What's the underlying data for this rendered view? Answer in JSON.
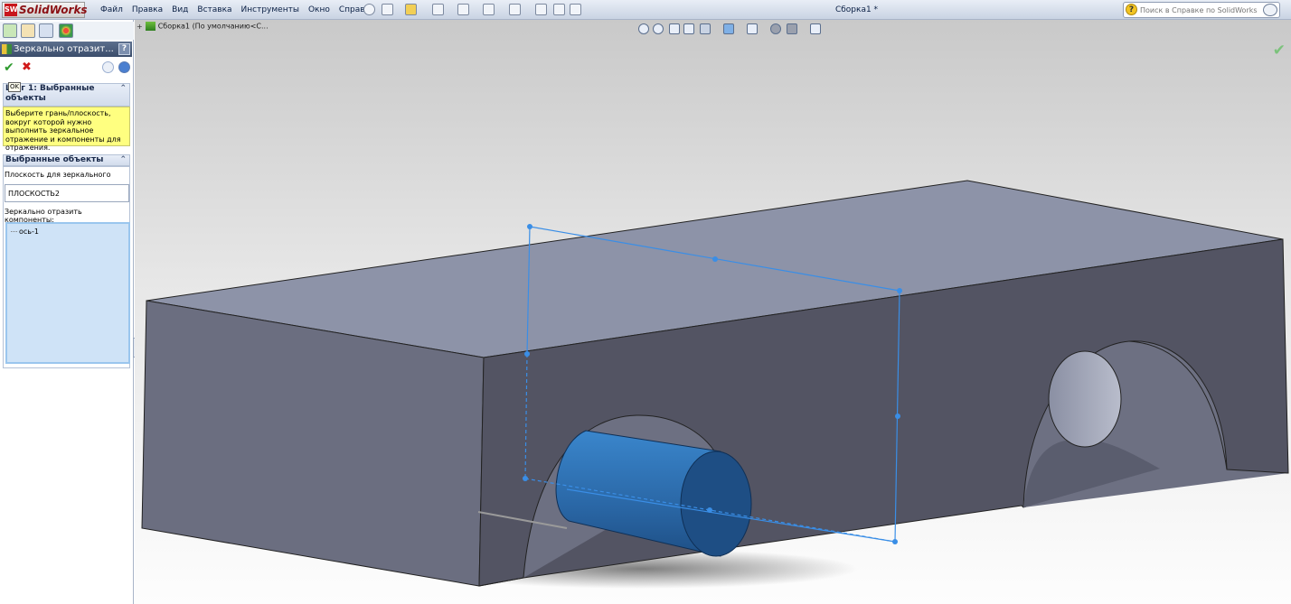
{
  "app": {
    "logo_badge": "SW",
    "logo_text": "SolidWorks"
  },
  "menu": [
    "Файл",
    "Правка",
    "Вид",
    "Вставка",
    "Инструменты",
    "Окно",
    "Справка"
  ],
  "document_title": "Сборка1 *",
  "search": {
    "placeholder": "Поиск в Справке по SolidWorks"
  },
  "property_manager": {
    "title": "Зеркально отразит...",
    "help_label": "?",
    "ok_symbol": "✔",
    "cancel_symbol": "✖",
    "ok_tooltip": "OK",
    "message_group": {
      "title": "Шаг 1: Выбранные объекты",
      "text": "Выберите грань/плоскость, вокруг которой нужно выполнить зеркальное отражение и компоненты для отражения."
    },
    "selection_group": {
      "title": "Выбранные объекты",
      "plane_label": "Плоскость для зеркального",
      "plane_value": "ПЛОСКОСТЬ2",
      "components_label": "Зеркально отразить компоненты:",
      "components": [
        "ось-1"
      ]
    }
  },
  "feature_tree": {
    "root_label": "Сборка1  (По умолчанию<С..."
  },
  "colors": {
    "body_top": "#8d93a8",
    "body_front": "#535463",
    "body_side": "#6b6e80",
    "cylinder": "#2f6fb0",
    "plane": "#3a8ee6"
  }
}
